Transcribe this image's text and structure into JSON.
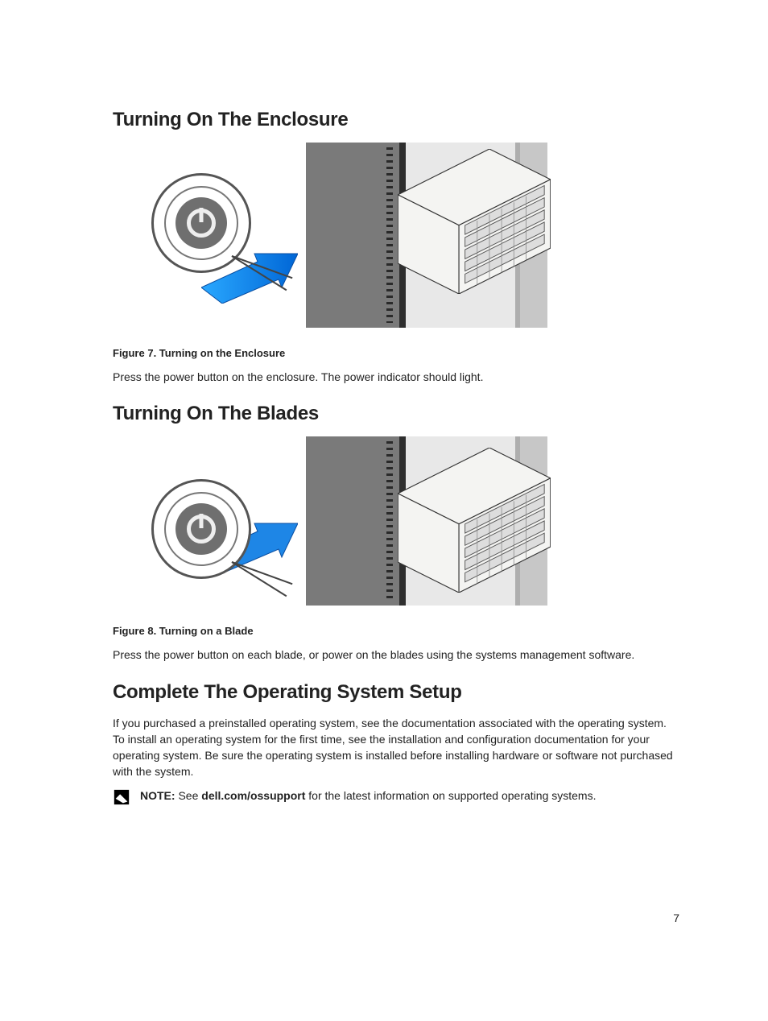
{
  "sections": {
    "enclosure": {
      "heading": "Turning On The Enclosure",
      "caption": "Figure 7. Turning on the Enclosure",
      "body": "Press the power button on the enclosure. The power indicator should light."
    },
    "blades": {
      "heading": "Turning On The Blades",
      "caption": "Figure 8. Turning on a Blade",
      "body": "Press the power button on each blade, or power on the blades using the systems management software."
    },
    "setup": {
      "heading": "Complete The Operating System Setup",
      "body": "If you purchased a preinstalled operating system, see the documentation associated with the operating system. To install an operating system for the first time, see the installation and configuration documentation for your operating system. Be sure the operating system is installed before installing hardware or software not purchased with the system.",
      "note_label": "NOTE:",
      "note_pre": " See ",
      "note_link": "dell.com/ossupport",
      "note_post": " for the latest information on supported operating systems."
    }
  },
  "page_number": "7"
}
